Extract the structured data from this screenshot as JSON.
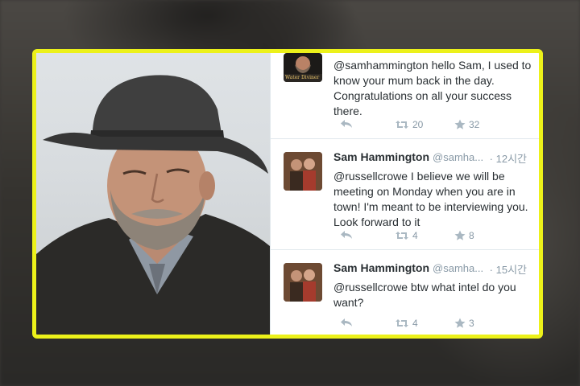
{
  "tweets": [
    {
      "name": "",
      "handle": "",
      "time": "",
      "text": "@samhammington hello Sam, I used to know your mum back in the day. Congratulations on all your success there.",
      "retweets": "20",
      "favorites": "32",
      "avatar_caption": "Water Diviner"
    },
    {
      "name": "Sam Hammington",
      "handle": "@samha...",
      "time": "12시간",
      "text": "@russellcrowe I believe we will be meeting on Monday when you are in town! I'm meant to be interviewing you. Look forward to it",
      "retweets": "4",
      "favorites": "8"
    },
    {
      "name": "Sam Hammington",
      "handle": "@samha...",
      "time": "15시간",
      "text": "@russellcrowe btw what intel do you want?",
      "retweets": "4",
      "favorites": "3"
    }
  ],
  "icons": {
    "reply": "reply-icon",
    "retweet": "retweet-icon",
    "favorite": "star-icon"
  },
  "colors": {
    "frame_border": "#ecf11a",
    "meta_text": "#8899a6",
    "tweet_text": "#292f33"
  }
}
